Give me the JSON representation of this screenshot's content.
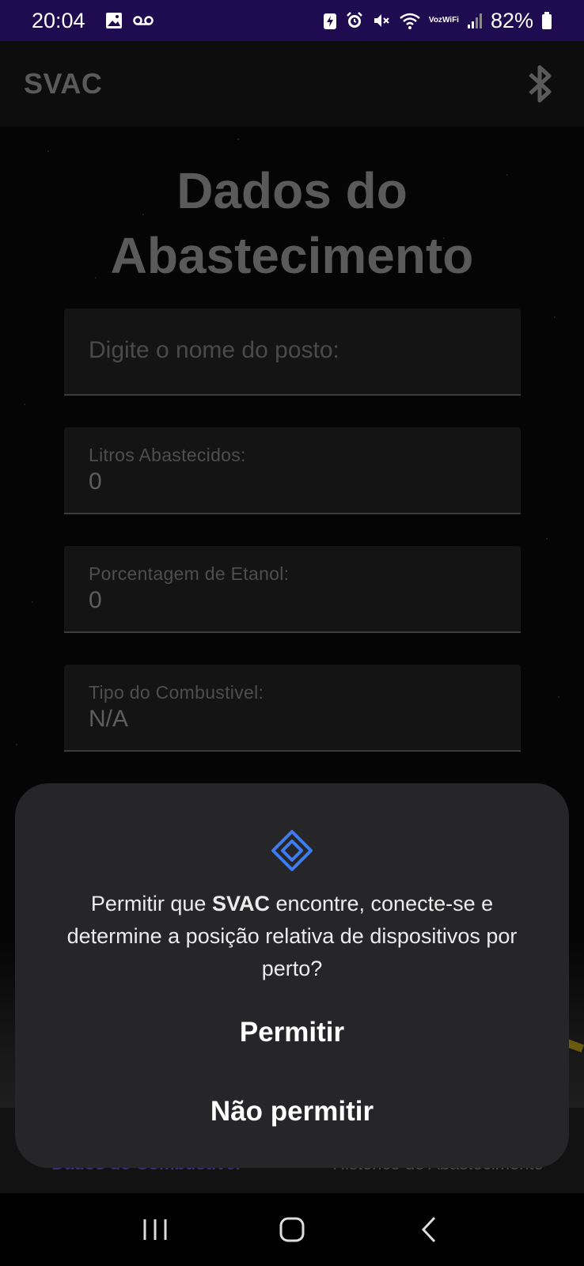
{
  "status_bar": {
    "time": "20:04",
    "voz": "Voz",
    "wifi": "WiFi",
    "battery": "82%"
  },
  "app_bar": {
    "title": "SVAC",
    "bluetooth_icon": "bluetooth-icon"
  },
  "page": {
    "title_line1": "Dados do",
    "title_line2": "Abastecimento"
  },
  "form": {
    "station_placeholder": "Digite o nome do posto:",
    "liters_label": "Litros Abastecidos:",
    "liters_value": "0",
    "ethanol_label": "Porcentagem de Etanol:",
    "ethanol_value": "0",
    "fuel_type_label": "Tipo do Combustivel:",
    "fuel_type_value": "N/A"
  },
  "bottom_nav": {
    "tabs": [
      {
        "label": "Dados do Combustivel",
        "active": true
      },
      {
        "label": "Historico de Abastecimento",
        "active": false
      }
    ]
  },
  "dialog": {
    "icon": "nearby-devices-icon",
    "message_prefix": "Permitir que ",
    "app_name": "SVAC",
    "message_suffix": " encontre, conecte-se e determine a posição relativa de dispositivos por perto?",
    "allow_label": "Permitir",
    "deny_label": "Não permitir",
    "accent_color": "#3f7cf0"
  },
  "colors": {
    "status_bar_bg": "#1f0c50",
    "dialog_bg": "#262628"
  }
}
